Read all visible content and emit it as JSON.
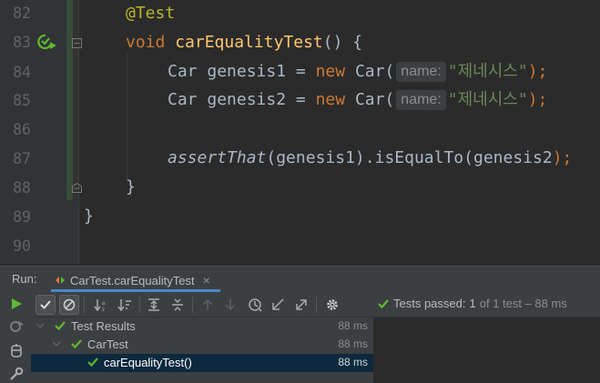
{
  "editor": {
    "line_numbers": [
      "82",
      "83",
      "84",
      "85",
      "86",
      "87",
      "88",
      "89",
      "90"
    ],
    "code": {
      "annotation": "@Test",
      "method_kw": "void",
      "method_name": "carEqualityTest",
      "method_tail": "() {",
      "car_type": "Car",
      "var1": "genesis1",
      "var2": "genesis2",
      "eq": " = ",
      "new_kw": "new",
      "ctor": "Car(",
      "hint_name": "name:",
      "str_val": "\"제네시스\"",
      "close": ");",
      "assert_fn": "assertThat",
      "assert_open": "(",
      "assert_arg": "genesis1",
      "assert_mid": ").",
      "assert_eq": "isEqualTo",
      "assert_arg2": "genesis2",
      "method_close": "}",
      "class_close": "}"
    }
  },
  "run_panel": {
    "title": "Run:",
    "tab_label": "CarTest.carEqualityTest",
    "tab_close": "×",
    "status_text": "Tests passed:",
    "status_passed": "1",
    "status_rest": "of 1 test – 88 ms",
    "tree": [
      {
        "label": "Test Results",
        "time": "88 ms"
      },
      {
        "label": "CarTest",
        "time": "88 ms"
      },
      {
        "label": "carEqualityTest()",
        "time": "88 ms"
      }
    ]
  },
  "icons": {
    "run_gutter": "run-test-icon",
    "rerun": "play-icon",
    "show_passed": "check-icon",
    "show_ignored": "no-icon",
    "sort_alpha": "sort-alphabetically-icon",
    "sort_duration": "sort-duration-icon",
    "expand_all": "expand-all-icon",
    "collapse_all": "collapse-all-icon",
    "prev_failed": "arrow-up-icon",
    "next_failed": "arrow-down-icon",
    "history": "history-icon",
    "import": "import-tests-icon",
    "export": "export-tests-icon",
    "settings": "gear-icon"
  },
  "colors": {
    "pass_green": "#5fb832",
    "selection": "#0d293e",
    "accent": "#4a88c7"
  }
}
